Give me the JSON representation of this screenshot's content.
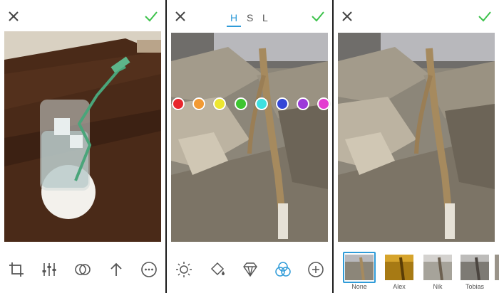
{
  "hsl_tabs": [
    "H",
    "S",
    "L"
  ],
  "hue_colors": [
    "#e8262d",
    "#f29a34",
    "#ede630",
    "#3ec531",
    "#3ee0e0",
    "#3446d6",
    "#9c3ad9",
    "#e33cd0"
  ],
  "accent": "#2f9bd8",
  "check_color": "#3cc24b",
  "filters": [
    "None",
    "Alex",
    "Nik",
    "Tobias"
  ],
  "selected_filter": "None"
}
